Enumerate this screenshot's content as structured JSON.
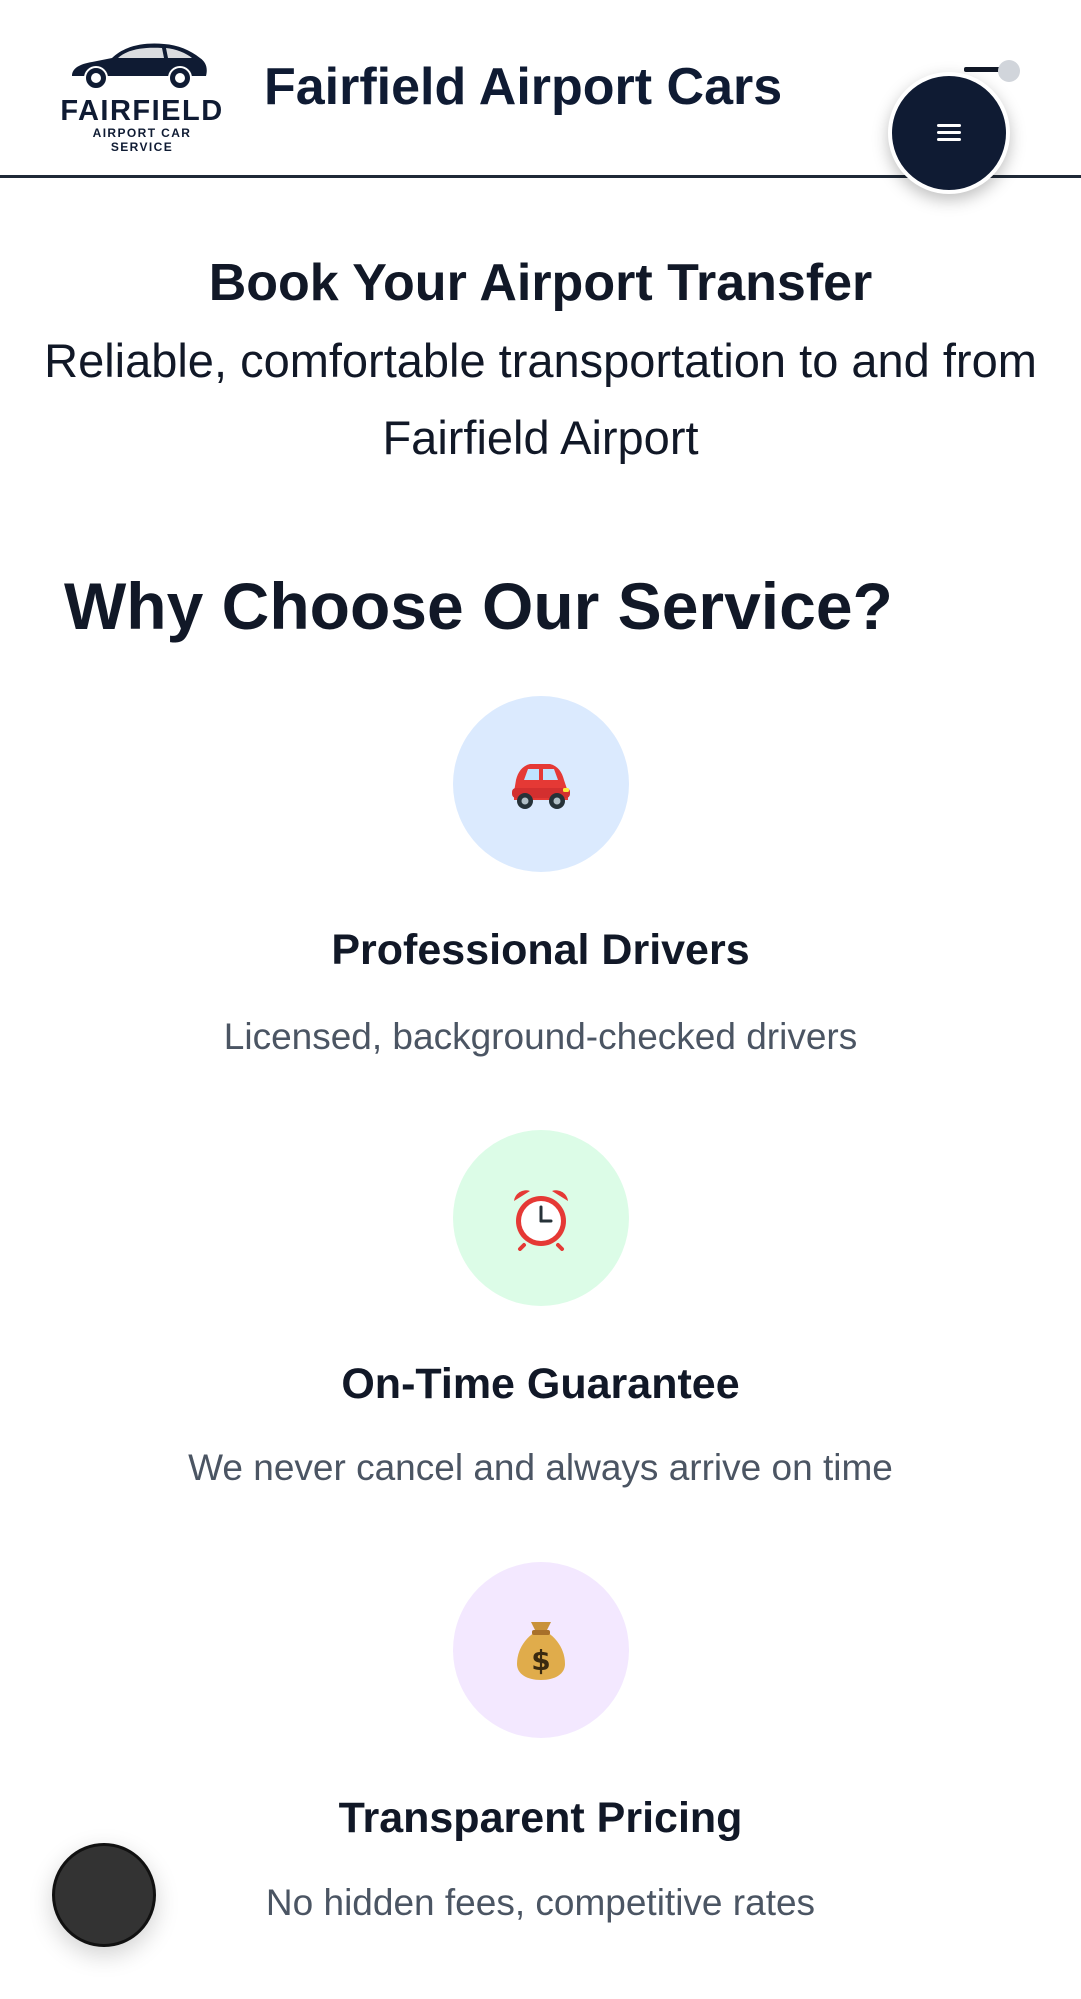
{
  "header": {
    "logo_word": "FAIRFIELD",
    "logo_sub": "AIRPORT CAR SERVICE",
    "site_title": "Fairfield Airport Cars",
    "menu_icon": "hamburger-icon"
  },
  "hero": {
    "title": "Book Your Airport Transfer",
    "subtitle": "Reliable, comfortable transportation to and from Fairfield Airport"
  },
  "why": {
    "title": "Why Choose Our Service?",
    "features": [
      {
        "icon": "car-icon",
        "emoji": "🚗",
        "bg": "#dbeafe",
        "title": "Professional Drivers",
        "desc": "Licensed, background-checked drivers"
      },
      {
        "icon": "alarm-clock-icon",
        "emoji": "⏰",
        "bg": "#dcfce7",
        "title": "On-Time Guarantee",
        "desc": "We never cancel and always arrive on time"
      },
      {
        "icon": "money-bag-icon",
        "emoji": "💰",
        "bg": "#f3e8ff",
        "title": "Transparent Pricing",
        "desc": "No hidden fees, competitive rates"
      }
    ]
  },
  "colors": {
    "brand_navy": "#0f1b33",
    "text_dark": "#111827",
    "text_muted": "#4b5563"
  },
  "chat": {
    "icon": "chat-icon"
  }
}
